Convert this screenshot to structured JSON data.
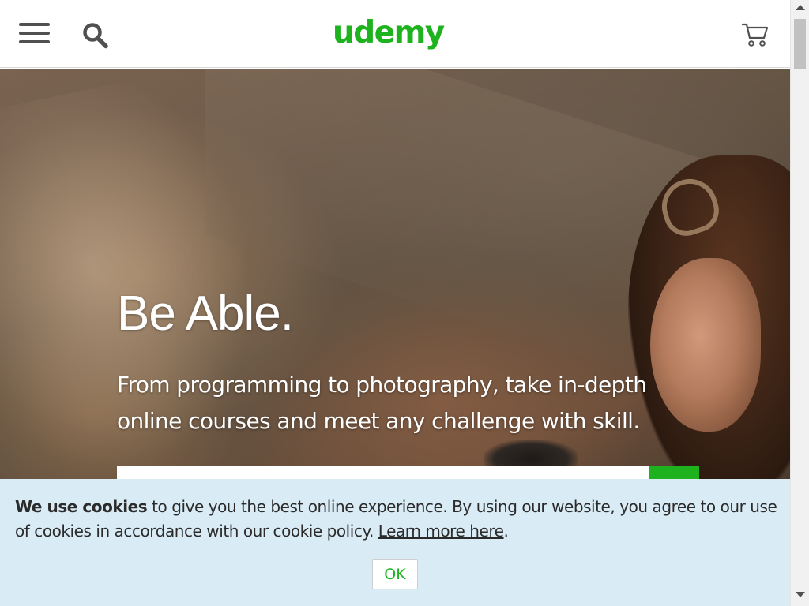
{
  "header": {
    "logo_text": "udemy",
    "brand_color": "#1eb31e",
    "icons": [
      "hamburger-menu-icon",
      "search-icon",
      "cart-icon"
    ]
  },
  "hero": {
    "title": "Be Able.",
    "subtitle": "From programming to photography, take in-depth online courses and meet any challenge with skill.",
    "search_placeholder": "",
    "search_button_color": "#1eb31e"
  },
  "cookie_banner": {
    "bold_text": "We use cookies",
    "text": " to give you the best online experience. By using our website, you agree to our use of cookies in accordance with our cookie policy. ",
    "link_text": "Learn more here",
    "trailing": ".",
    "ok_label": "OK",
    "background_color": "#d9ebf5"
  }
}
